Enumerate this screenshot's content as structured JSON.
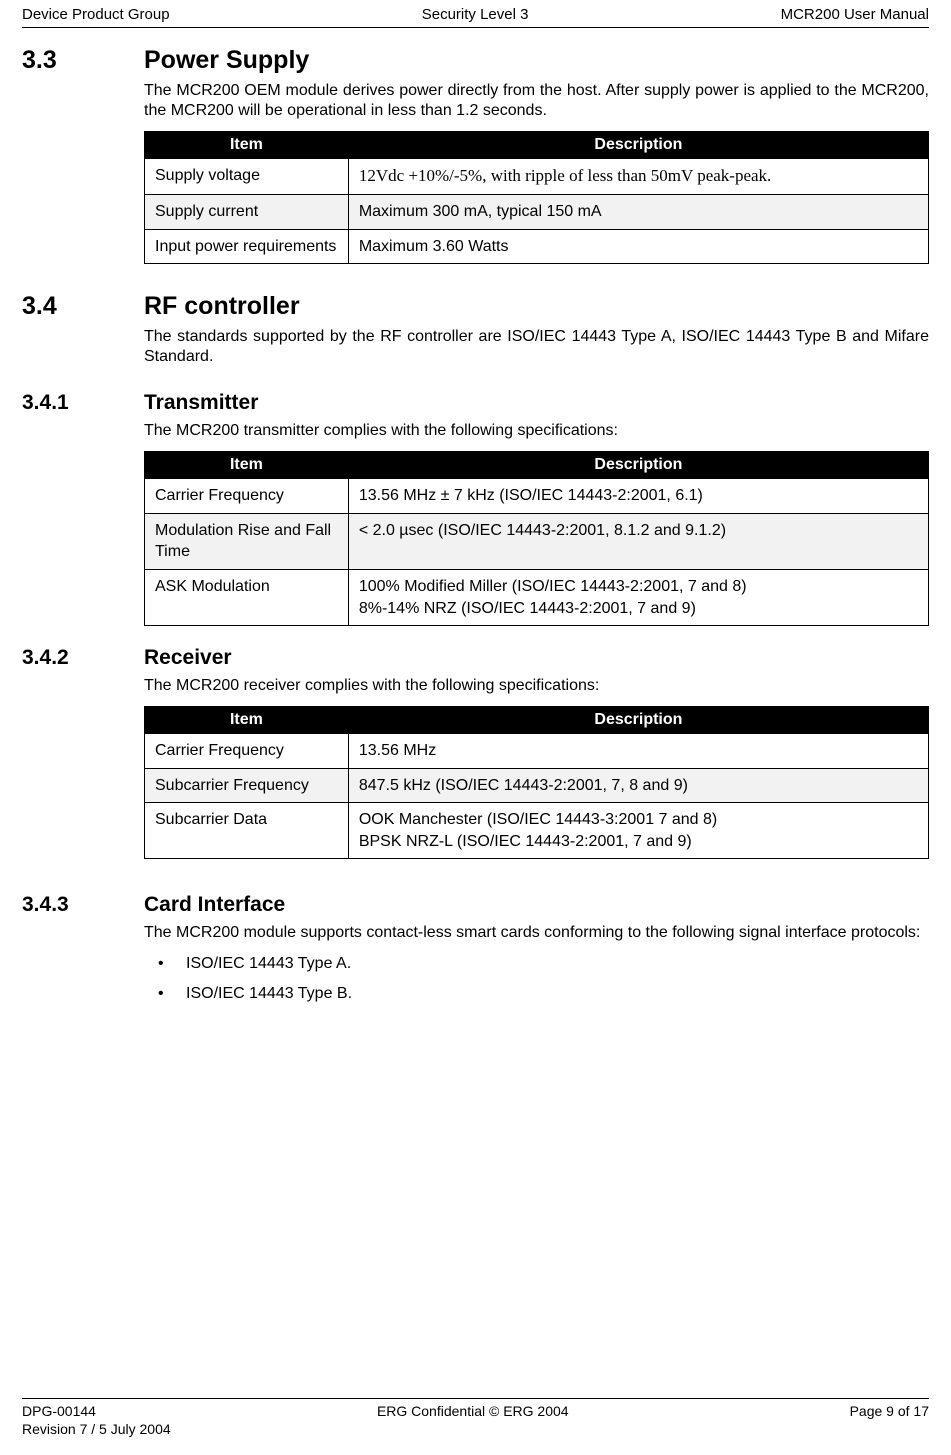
{
  "header": {
    "left": "Device Product Group",
    "center": "Security Level 3",
    "right": "MCR200 User Manual"
  },
  "sections": {
    "s33": {
      "num": "3.3",
      "title": "Power Supply",
      "para": "The MCR200 OEM module derives power directly from the host. After supply power is applied to the MCR200, the MCR200 will be operational in less than 1.2 seconds.",
      "th_item": "Item",
      "th_desc": "Description",
      "rows": [
        {
          "item": "Supply voltage",
          "desc": "12Vdc +10%/-5%, with ripple of less than 50mV peak-peak."
        },
        {
          "item": "Supply current",
          "desc": "Maximum 300 mA, typical 150 mA"
        },
        {
          "item": "Input power requirements",
          "desc": "Maximum 3.60 Watts"
        }
      ]
    },
    "s34": {
      "num": "3.4",
      "title": "RF controller",
      "para": "The standards supported by the RF controller are ISO/IEC 14443 Type A, ISO/IEC 14443 Type B and Mifare Standard."
    },
    "s341": {
      "num": "3.4.1",
      "title": "Transmitter",
      "para": "The MCR200 transmitter complies with the following specifications:",
      "th_item": "Item",
      "th_desc": "Description",
      "rows": [
        {
          "item": "Carrier Frequency",
          "desc": "13.56 MHz ± 7 kHz (ISO/IEC 14443-2:2001, 6.1)"
        },
        {
          "item": "Modulation Rise and Fall Time",
          "desc": "< 2.0 µsec (ISO/IEC 14443-2:2001, 8.1.2 and 9.1.2)"
        },
        {
          "item": "ASK Modulation",
          "desc": "100% Modified Miller (ISO/IEC 14443-2:2001, 7 and 8)\n8%-14% NRZ (ISO/IEC 14443-2:2001, 7 and 9)"
        }
      ]
    },
    "s342": {
      "num": "3.4.2",
      "title": "Receiver",
      "para": "The MCR200 receiver complies with the following specifications:",
      "th_item": "Item",
      "th_desc": "Description",
      "rows": [
        {
          "item": "Carrier Frequency",
          "desc": "13.56 MHz"
        },
        {
          "item": "Subcarrier Frequency",
          "desc": "847.5 kHz (ISO/IEC 14443-2:2001, 7, 8 and 9)"
        },
        {
          "item": "Subcarrier Data",
          "desc": "OOK Manchester (ISO/IEC 14443-3:2001 7 and 8)\nBPSK NRZ-L (ISO/IEC 14443-2:2001, 7 and 9)"
        }
      ]
    },
    "s343": {
      "num": "3.4.3",
      "title": "Card Interface",
      "para": "The MCR200 module supports contact-less smart cards conforming to the following signal interface protocols:",
      "bullets": [
        "ISO/IEC 14443 Type A.",
        "ISO/IEC 14443 Type B."
      ]
    }
  },
  "footer": {
    "left1": "DPG-00144",
    "left2": "Revision 7 / 5 July 2004",
    "center": "ERG Confidential © ERG 2004",
    "right": "Page 9 of 17"
  }
}
